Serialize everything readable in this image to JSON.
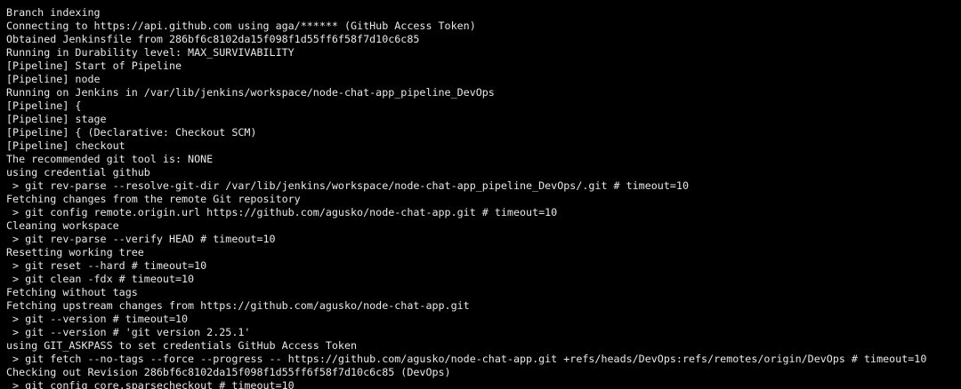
{
  "console": {
    "lines": [
      "Branch indexing",
      "Connecting to https://api.github.com using aga/****** (GitHub Access Token)",
      "Obtained Jenkinsfile from 286bf6c8102da15f098f1d55ff6f58f7d10c6c85",
      "Running in Durability level: MAX_SURVIVABILITY",
      "[Pipeline] Start of Pipeline",
      "[Pipeline] node",
      "Running on Jenkins in /var/lib/jenkins/workspace/node-chat-app_pipeline_DevOps",
      "[Pipeline] {",
      "[Pipeline] stage",
      "[Pipeline] { (Declarative: Checkout SCM)",
      "[Pipeline] checkout",
      "The recommended git tool is: NONE",
      "using credential github",
      " > git rev-parse --resolve-git-dir /var/lib/jenkins/workspace/node-chat-app_pipeline_DevOps/.git # timeout=10",
      "Fetching changes from the remote Git repository",
      " > git config remote.origin.url https://github.com/agusko/node-chat-app.git # timeout=10",
      "Cleaning workspace",
      " > git rev-parse --verify HEAD # timeout=10",
      "Resetting working tree",
      " > git reset --hard # timeout=10",
      " > git clean -fdx # timeout=10",
      "Fetching without tags",
      "Fetching upstream changes from https://github.com/agusko/node-chat-app.git",
      " > git --version # timeout=10",
      " > git --version # 'git version 2.25.1'",
      "using GIT_ASKPASS to set credentials GitHub Access Token",
      " > git fetch --no-tags --force --progress -- https://github.com/agusko/node-chat-app.git +refs/heads/DevOps:refs/remotes/origin/DevOps # timeout=10",
      "Checking out Revision 286bf6c8102da15f098f1d55ff6f58f7d10c6c85 (DevOps)",
      " > git config core.sparsecheckout # timeout=10"
    ]
  }
}
